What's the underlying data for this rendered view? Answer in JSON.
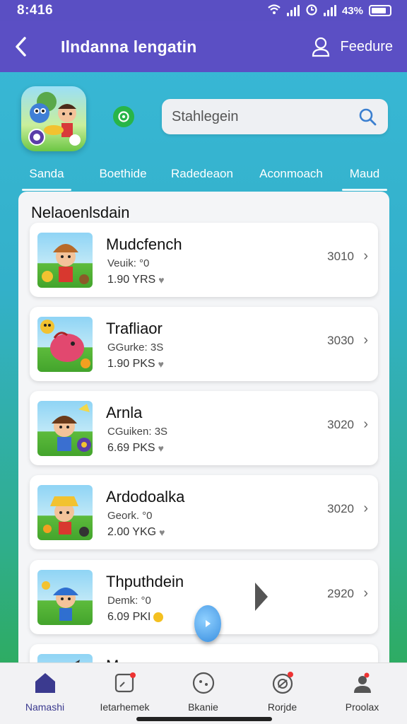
{
  "status_bar": {
    "time": "8:416",
    "battery": "43%"
  },
  "app_bar": {
    "title": "Ilndanna lengatin",
    "feature_label": "Feedure"
  },
  "search": {
    "placeholder": "Stahlegein"
  },
  "tabs": [
    {
      "label": "Sanda",
      "active": true
    },
    {
      "label": "Boethide",
      "active": false
    },
    {
      "label": "Radedeaon",
      "active": false
    },
    {
      "label": "Aconmoach",
      "active": false
    },
    {
      "label": "Maud",
      "active": true
    }
  ],
  "list": {
    "title": "Nelaoenlsdain",
    "items": [
      {
        "title": "Mudcfench",
        "subtitle": "Veuik: °0",
        "meta": "1.90 YRS",
        "count": "3010",
        "marker": "heart"
      },
      {
        "title": "Trafliaor",
        "subtitle": "GGurke: 3S",
        "meta": "1.90 PKS",
        "count": "3030",
        "marker": "heart"
      },
      {
        "title": "Arnla",
        "subtitle": "CGuiken: 3S",
        "meta": "6.69 PKS",
        "count": "3020",
        "marker": "heart"
      },
      {
        "title": "Ardodoalka",
        "subtitle": "Geork. °0",
        "meta": "2.00 YKG",
        "count": "3020",
        "marker": "heart"
      },
      {
        "title": "Thputhdein",
        "subtitle": "Demk: °0",
        "meta": "6.09 PKI",
        "count": "2920",
        "marker": "dot"
      },
      {
        "title": "M-c",
        "subtitle": "",
        "meta": "",
        "count": "",
        "marker": ""
      }
    ]
  },
  "bottom_nav": [
    {
      "label": "Namashi",
      "icon": "home-icon",
      "active": true
    },
    {
      "label": "Ietarhemek",
      "icon": "notification-icon",
      "active": false
    },
    {
      "label": "Bkanie",
      "icon": "chat-icon",
      "active": false
    },
    {
      "label": "Rorjde",
      "icon": "target-icon",
      "active": false
    },
    {
      "label": "Proolax",
      "icon": "profile-icon",
      "active": false
    }
  ],
  "colors": {
    "header": "#5b4fc4",
    "accent": "#3b3a8f",
    "background_top": "#39b9d8",
    "background_bottom": "#2eaa4e"
  }
}
